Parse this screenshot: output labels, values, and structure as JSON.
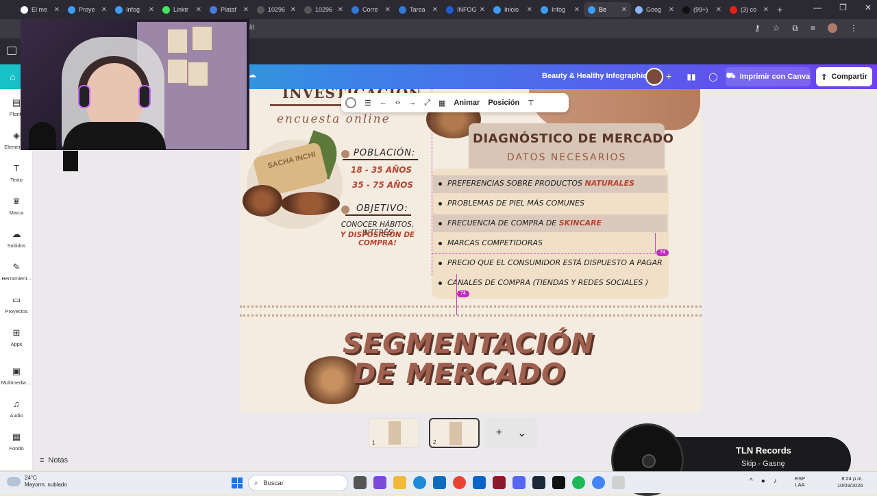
{
  "browser": {
    "tabs": [
      {
        "label": "El me",
        "color": "#fff"
      },
      {
        "label": "Proye",
        "color": "#3d9df6"
      },
      {
        "label": "Infog",
        "color": "#3d9df6"
      },
      {
        "label": "Linktr",
        "color": "#43e660"
      },
      {
        "label": "Plataf",
        "color": "#4a7bd8"
      },
      {
        "label": "10296",
        "color": "#555"
      },
      {
        "label": "10296",
        "color": "#555"
      },
      {
        "label": "Corre",
        "color": "#2f7ad8"
      },
      {
        "label": "Tarea",
        "color": "#2f7ad8"
      },
      {
        "label": "INFOG",
        "color": "#1e5bd6"
      },
      {
        "label": "Inicio",
        "color": "#3d9df6"
      },
      {
        "label": "Infog",
        "color": "#3d9df6"
      },
      {
        "label": "Be",
        "color": "#3d9df6",
        "active": true
      },
      {
        "label": "Goog",
        "color": "#8ab4f8"
      },
      {
        "label": "(99+)",
        "color": "#111"
      },
      {
        "label": "(3) co",
        "color": "#e62117"
      }
    ],
    "address_text": "lit"
  },
  "canva": {
    "doc_title": "Beauty & Healthy Infographic",
    "print_label": "Imprimir con Canva",
    "share_label": "Compartir"
  },
  "sidebar": {
    "items": [
      {
        "label": "Plantil",
        "icon": "template-icon"
      },
      {
        "label": "Elementos",
        "icon": "elements-icon"
      },
      {
        "label": "Texto",
        "icon": "text-icon"
      },
      {
        "label": "Marca",
        "icon": "brand-icon"
      },
      {
        "label": "Subidos",
        "icon": "upload-icon"
      },
      {
        "label": "Herramient...",
        "icon": "draw-icon"
      },
      {
        "label": "Proyectos",
        "icon": "folder-icon"
      },
      {
        "label": "Apps",
        "icon": "apps-icon"
      },
      {
        "label": "Multimedia ...",
        "icon": "media-icon"
      },
      {
        "label": "Audio",
        "icon": "audio-icon"
      },
      {
        "label": "Fondo",
        "icon": "background-icon"
      }
    ]
  },
  "toolbar": {
    "animate_label": "Animar",
    "position_label": "Posición"
  },
  "design": {
    "investigation_title": "INVESTIGACIÓN",
    "investigation_sub": "encuesta online",
    "soap_text": "SACHA INCHI",
    "population_label": "POBLACIÓN:",
    "population_range1": "18 - 35 AÑOS",
    "population_range2": "35 - 75 AÑOS",
    "objective_label": "OBJETIVO:",
    "objective_text1": "CONOCER HÁBITOS, INTERÉS",
    "objective_text2": "Y DISPOSICIÓN DE COMPRA!",
    "diag_title": "DIAGNÓSTICO DE MERCADO",
    "diag_sub": "DATOS NECESARIOS",
    "list": [
      {
        "text": "PREFERENCIAS SOBRE PRODUCTOS",
        "accent": "NATURALES"
      },
      {
        "text": "PROBLEMAS DE PIEL MÁS COMUNES",
        "accent": ""
      },
      {
        "text": "FRECUENCIA DE COMPRA DE",
        "accent": "SKINCARE"
      },
      {
        "text": "MARCAS COMPETIDORAS",
        "accent": ""
      },
      {
        "text": "PRECIO QUE EL CONSUMIDOR ESTÁ DISPUESTO A PAGAR",
        "accent": ""
      },
      {
        "text": "CANALES DE COMPRA (TIENDAS Y REDES SOCIALES )",
        "accent": ""
      }
    ],
    "guide_badge": "74",
    "seg_title1": "SEGMENTACIÓN",
    "seg_title2": "DE MERCADO"
  },
  "pages": {
    "page1": "1",
    "page2": "2",
    "add_icon": "+",
    "chevron": "⌄"
  },
  "notes_label": "Notas",
  "music": {
    "title": "TLN Records",
    "subtitle": "Skip - Gasnę"
  },
  "taskbar": {
    "temp": "24°C",
    "weather": "Mayorm. nublado",
    "search_placeholder": "Buscar",
    "lang1": "ESP",
    "lang2": "LAA",
    "time": "8:24 p.m.",
    "date": "10/03/2026"
  }
}
